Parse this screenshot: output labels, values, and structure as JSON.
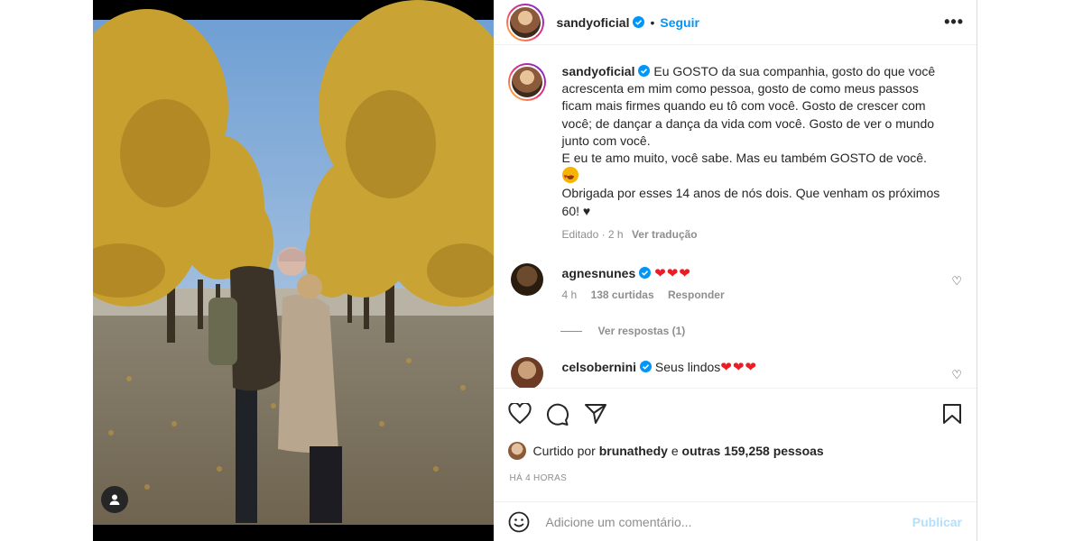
{
  "header": {
    "username": "sandyoficial",
    "dot": "•",
    "follow_label": "Seguir",
    "more_label": "•••"
  },
  "caption": {
    "username": "sandyoficial",
    "text_1": "Eu GOSTO da sua companhia, gosto do que você acrescenta em mim como pessoa, gosto de como meus passos ficam mais firmes quando eu tô com você. Gosto de crescer com você; de dançar a dança da vida com você. Gosto de ver o mundo junto com você.",
    "text_2": "E eu te amo muito, você sabe. Mas eu também GOSTO de você.",
    "text_3": "Obrigada por esses 14 anos de nós dois. Que venham os próximos 60! ♥",
    "edited": "Editado · 2 h",
    "translate": "Ver tradução"
  },
  "comments": [
    {
      "username": "agnesnunes",
      "text": "❤❤❤",
      "time": "4 h",
      "likes": "138 curtidas",
      "reply": "Responder",
      "view_replies": "Ver respostas (1)"
    },
    {
      "username": "celsobernini",
      "text": "Seus lindos",
      "hearts": "❤❤❤"
    }
  ],
  "likes": {
    "prefix": "Curtido por",
    "user": "brunathedy",
    "conj": "e",
    "others": "outras 159,258 pessoas"
  },
  "time_ago": "HÁ 4 HORAS",
  "add_comment": {
    "placeholder": "Adicione um comentário...",
    "publish": "Publicar"
  },
  "colors": {
    "accent": "#0095f6",
    "heart": "#ed4956",
    "publish_disabled": "#b2dffc"
  }
}
